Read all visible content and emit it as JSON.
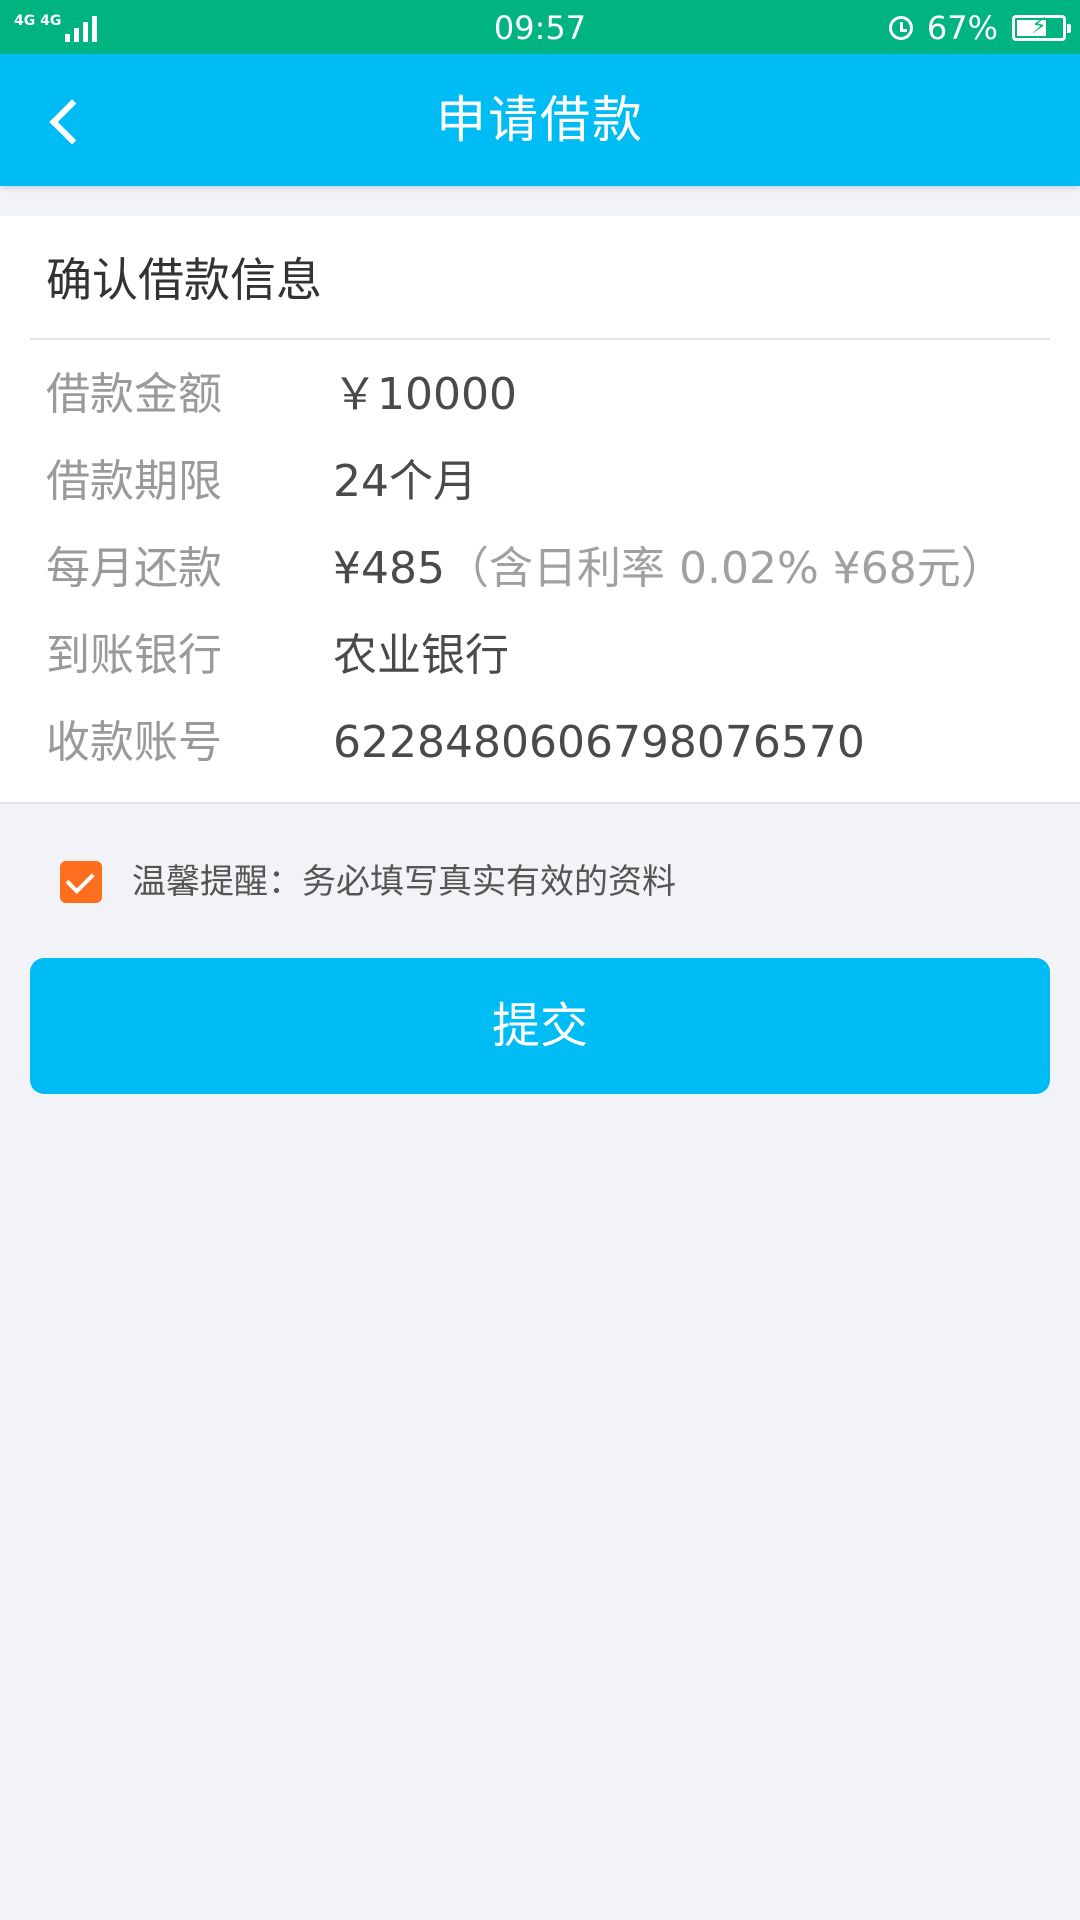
{
  "status_bar": {
    "network": "4G 4G",
    "time": "09:57",
    "battery_percent_label": "67%",
    "battery_level": 0.67,
    "icons": [
      "signal-icon",
      "alarm-icon",
      "battery-charging-icon"
    ]
  },
  "nav": {
    "back_icon": "chevron-left-icon",
    "title": "申请借款"
  },
  "card": {
    "title": "确认借款信息",
    "rows": [
      {
        "label": "借款金额",
        "value": "￥10000",
        "note": ""
      },
      {
        "label": "借款期限",
        "value": "24个月",
        "note": ""
      },
      {
        "label": "每月还款",
        "value": "¥485",
        "note": "（含日利率 0.02% ¥68元）"
      },
      {
        "label": "到账银行",
        "value": "农业银行",
        "note": ""
      },
      {
        "label": "收款账号",
        "value": "6228480606798076570",
        "note": ""
      }
    ]
  },
  "reminder": {
    "checked": true,
    "text": "温馨提醒：务必填写真实有效的资料"
  },
  "submit": {
    "label": "提交"
  },
  "colors": {
    "status_bar": "#00b482",
    "primary": "#00bcf5",
    "checkbox": "#ff6d1e",
    "background": "#f2f3f7"
  }
}
